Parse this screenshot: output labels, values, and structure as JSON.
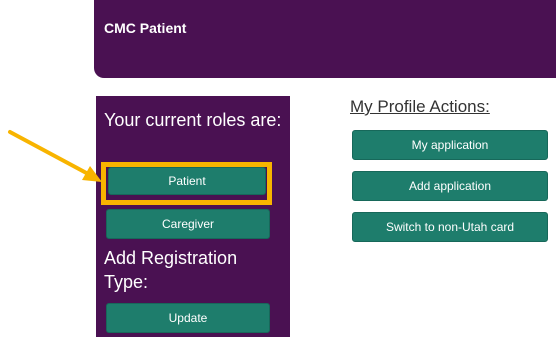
{
  "header": {
    "title": "CMC Patient"
  },
  "roles": {
    "heading": "Your current roles are:",
    "buttons": [
      "Patient",
      "Caregiver"
    ]
  },
  "registration": {
    "heading": "Add Registration Type:",
    "button": "Update"
  },
  "profile_actions": {
    "heading": "My Profile Actions:",
    "buttons": [
      "My application",
      "Add application",
      "Switch to non-Utah card"
    ]
  },
  "colors": {
    "brand_purple": "#4a1152",
    "teal_button": "#1e7d6c",
    "highlight_yellow": "#f8b400"
  }
}
